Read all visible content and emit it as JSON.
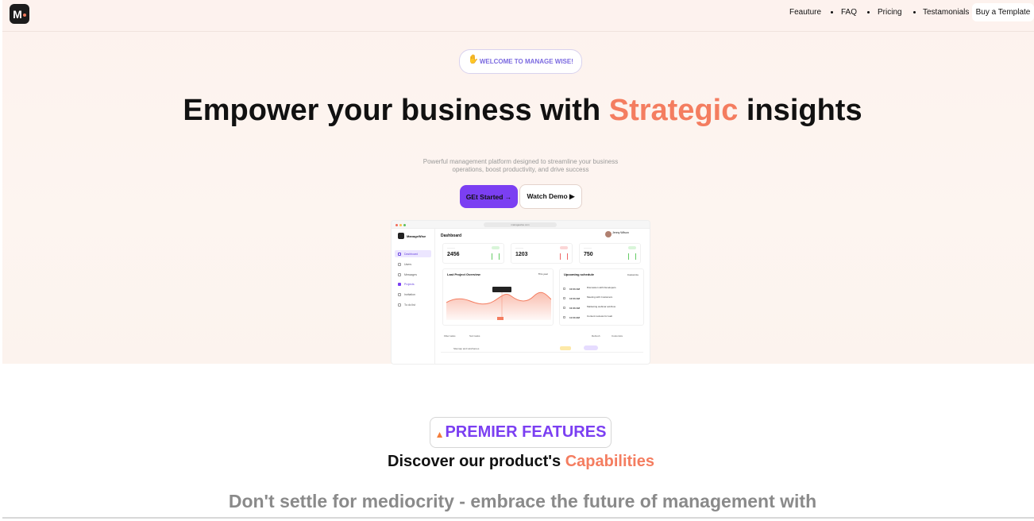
{
  "nav": {
    "logo_letter": "M",
    "items": [
      "Feauture",
      "FAQ",
      "Pricing",
      "Testamonials"
    ],
    "buy_label": "Buy a Template"
  },
  "hero": {
    "badge_icon": "waving-hand-icon",
    "badge": "WELCOME TO MANAGE WISE!",
    "headline_pre": "Empower your business with ",
    "headline_accent": "Strategic",
    "headline_post": " insights",
    "subtext": "Powerful management platform designed to streamline your business operations, boost productivity, and drive success",
    "start_label": "GEt Started →",
    "demo_label": "Watch Demo ▶"
  },
  "mockup": {
    "url": "managewise.com",
    "brand": "ManageWise",
    "title": "Dashboard",
    "user": "Jenny Wilson",
    "sidebar": [
      "Dashboard",
      "Users",
      "Messages",
      "Projects",
      "Invitation",
      "To do list"
    ],
    "cards": [
      {
        "value": "2456"
      },
      {
        "value": "1203"
      },
      {
        "value": "750"
      }
    ],
    "chart_title": "Last Project Overview",
    "chart_period": "This year",
    "schedule_title": "Upcoming schedule",
    "schedule_action": "Customize",
    "schedule": [
      {
        "time": "10:00 AM",
        "name": "Discussion with Developers"
      },
      {
        "time": "12:00 AM",
        "name": "Meeting with Customers"
      },
      {
        "time": "10:30 AM",
        "name": "Marketing webinar ad-Flow"
      },
      {
        "time": "11:00 AM",
        "name": "Content reviews for web"
      }
    ],
    "table_filters": [
      "Filter tasks",
      "Sort tasks"
    ],
    "table_actions": [
      "Refresh",
      "Customize"
    ],
    "table_row": "Sitemap and wireframes"
  },
  "features": {
    "badge_icon": "fire-icon",
    "badge": "PREMIER FEATURES",
    "heading_pre": "Discover our product's ",
    "heading_accent": "Capabilities",
    "sub": "Don't settle for mediocrity - embrace the future of management with ManageWise"
  },
  "colors": {
    "accent_orange": "#f47d60",
    "accent_purple": "#7b3ff2"
  }
}
